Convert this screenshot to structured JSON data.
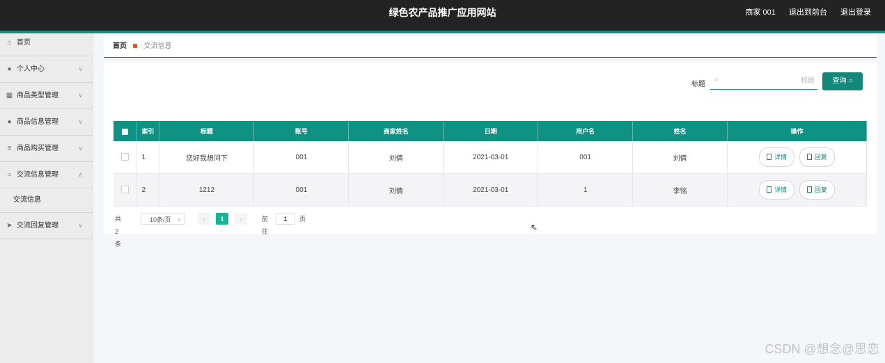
{
  "header": {
    "title": "绿色农产品推广应用网站",
    "user": "商家 001",
    "to_front": "退出到前台",
    "logout": "退出登录"
  },
  "sidebar": {
    "items": [
      {
        "label": "首页",
        "icon": "home-icon"
      },
      {
        "label": "个人中心",
        "icon": "user-icon"
      },
      {
        "label": "商品类型管理",
        "icon": "grid-icon"
      },
      {
        "label": "商品信息管理",
        "icon": "user-icon"
      },
      {
        "label": "商品购买管理",
        "icon": "list-icon"
      },
      {
        "label": "交流信息管理",
        "icon": "power-icon"
      },
      {
        "label": "交流信息",
        "icon": ""
      },
      {
        "label": "交流回复管理",
        "icon": "send-icon"
      }
    ]
  },
  "breadcrumb": {
    "home": "首页",
    "current": "交流信息"
  },
  "search": {
    "label": "标题",
    "placeholder": "标题",
    "button": "查询"
  },
  "table": {
    "columns": [
      "索引",
      "标题",
      "账号",
      "商家姓名",
      "日期",
      "用户名",
      "姓名",
      "操作"
    ],
    "rows": [
      {
        "index": "1",
        "title": "您好我想问下",
        "account": "001",
        "merchant": "刘倩",
        "date": "2021-03-01",
        "username": "001",
        "name": "刘倩"
      },
      {
        "index": "2",
        "title": "1212",
        "account": "001",
        "merchant": "刘倩",
        "date": "2021-03-01",
        "username": "1",
        "name": "李铭"
      }
    ],
    "detail_label": "详情",
    "reply_label": "回复"
  },
  "pager": {
    "total": "共 2 条",
    "page_size": "10条/页",
    "current": "1",
    "goto_label": "前往",
    "goto_value": "1",
    "page_suffix": "页"
  },
  "watermark": "CSDN @想念@思恋",
  "colors": {
    "accent": "#0f9184",
    "header": "#232323",
    "active_page": "#13b592"
  }
}
